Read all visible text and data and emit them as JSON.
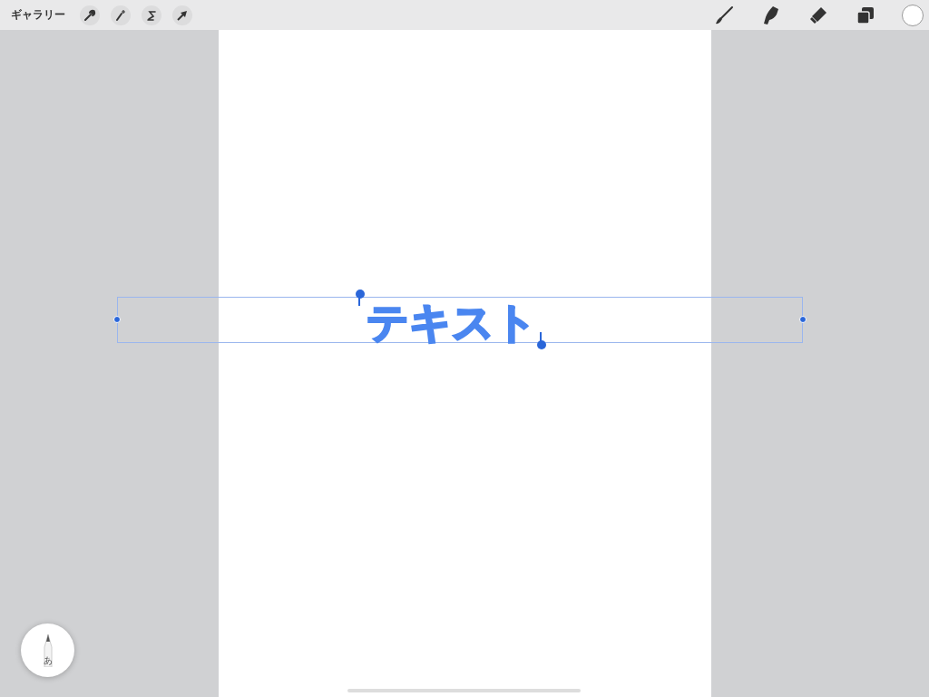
{
  "top_bar": {
    "gallery_button": "ギャラリー"
  },
  "canvas": {
    "text_object": {
      "text": "テキスト",
      "selected": true
    }
  },
  "pencil_button": {
    "label": "あ"
  }
}
